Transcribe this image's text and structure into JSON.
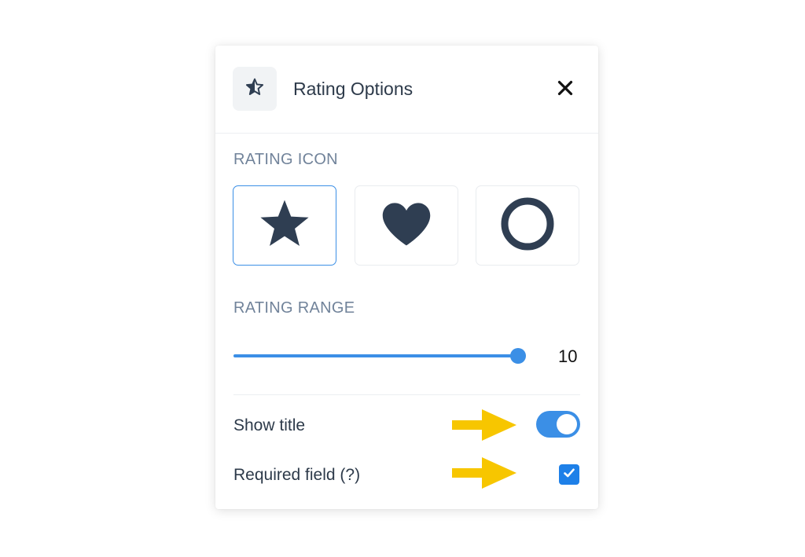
{
  "panel": {
    "title": "Rating Options",
    "close_icon": "close-icon",
    "header_icon": "half-star-icon"
  },
  "rating_icon": {
    "label": "RATING ICON",
    "options": [
      {
        "name": "star",
        "icon": "star-icon",
        "selected": true
      },
      {
        "name": "heart",
        "icon": "heart-icon",
        "selected": false
      },
      {
        "name": "circle",
        "icon": "circle-icon",
        "selected": false
      }
    ]
  },
  "rating_range": {
    "label": "RATING RANGE",
    "value": "10",
    "level": 1.0
  },
  "show_title": {
    "label": "Show title",
    "enabled": true
  },
  "required_field": {
    "label": "Required field (?)",
    "checked": true
  },
  "annotations": {
    "arrow_color": "#f7c600",
    "arrow_icon": "arrow-right-icon"
  },
  "colors": {
    "accent": "#3b8fe6",
    "checkbox": "#1e80e8",
    "icon": "#2f3e52",
    "section_label": "#71839a"
  }
}
